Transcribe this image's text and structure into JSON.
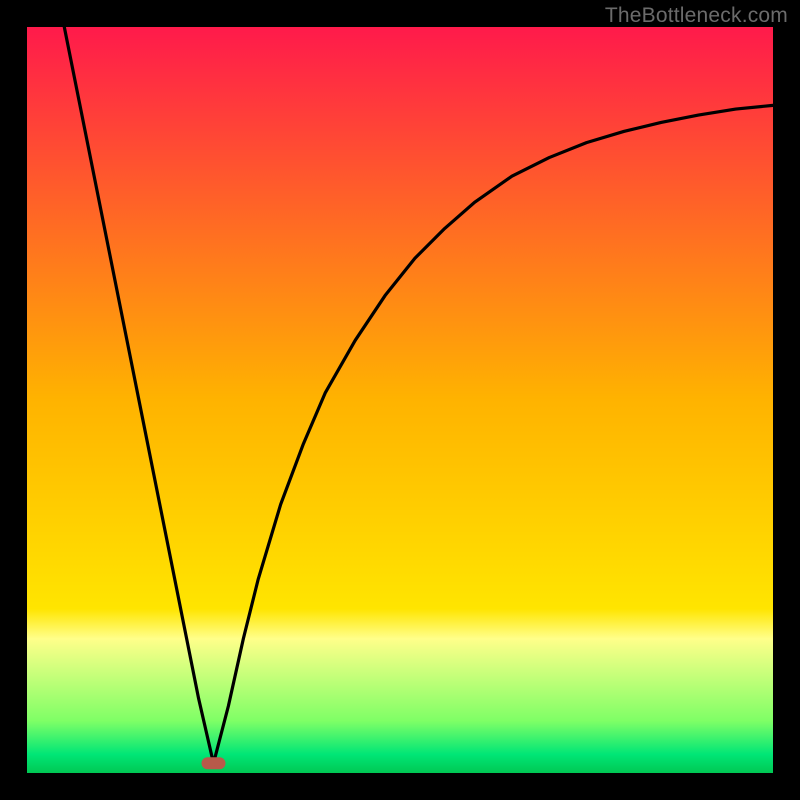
{
  "watermark": {
    "text": "TheBottleneck.com"
  },
  "chart_data": {
    "type": "line",
    "title": "",
    "xlabel": "",
    "ylabel": "",
    "xlim": [
      0,
      100
    ],
    "ylim": [
      0,
      100
    ],
    "grid": false,
    "legend": false,
    "background_gradient": {
      "stops": [
        {
          "pos": 0.0,
          "color": "#ff1a4b"
        },
        {
          "pos": 0.5,
          "color": "#ffb300"
        },
        {
          "pos": 0.78,
          "color": "#ffe500"
        },
        {
          "pos": 0.82,
          "color": "#ffff8a"
        },
        {
          "pos": 0.93,
          "color": "#7fff66"
        },
        {
          "pos": 0.975,
          "color": "#00e676"
        },
        {
          "pos": 1.0,
          "color": "#00c853"
        }
      ]
    },
    "marker": {
      "x": 25,
      "y": 1.3,
      "color": "#b85a4a"
    },
    "series": [
      {
        "name": "curve",
        "x": [
          5,
          7,
          9,
          11,
          13,
          15,
          17,
          19,
          21,
          23,
          25,
          27,
          29,
          31,
          34,
          37,
          40,
          44,
          48,
          52,
          56,
          60,
          65,
          70,
          75,
          80,
          85,
          90,
          95,
          100
        ],
        "y": [
          100,
          90,
          80,
          70,
          60,
          50,
          40,
          30,
          20,
          10,
          1.3,
          9,
          18,
          26,
          36,
          44,
          51,
          58,
          64,
          69,
          73,
          76.5,
          80,
          82.5,
          84.5,
          86,
          87.2,
          88.2,
          89,
          89.5
        ]
      }
    ]
  }
}
